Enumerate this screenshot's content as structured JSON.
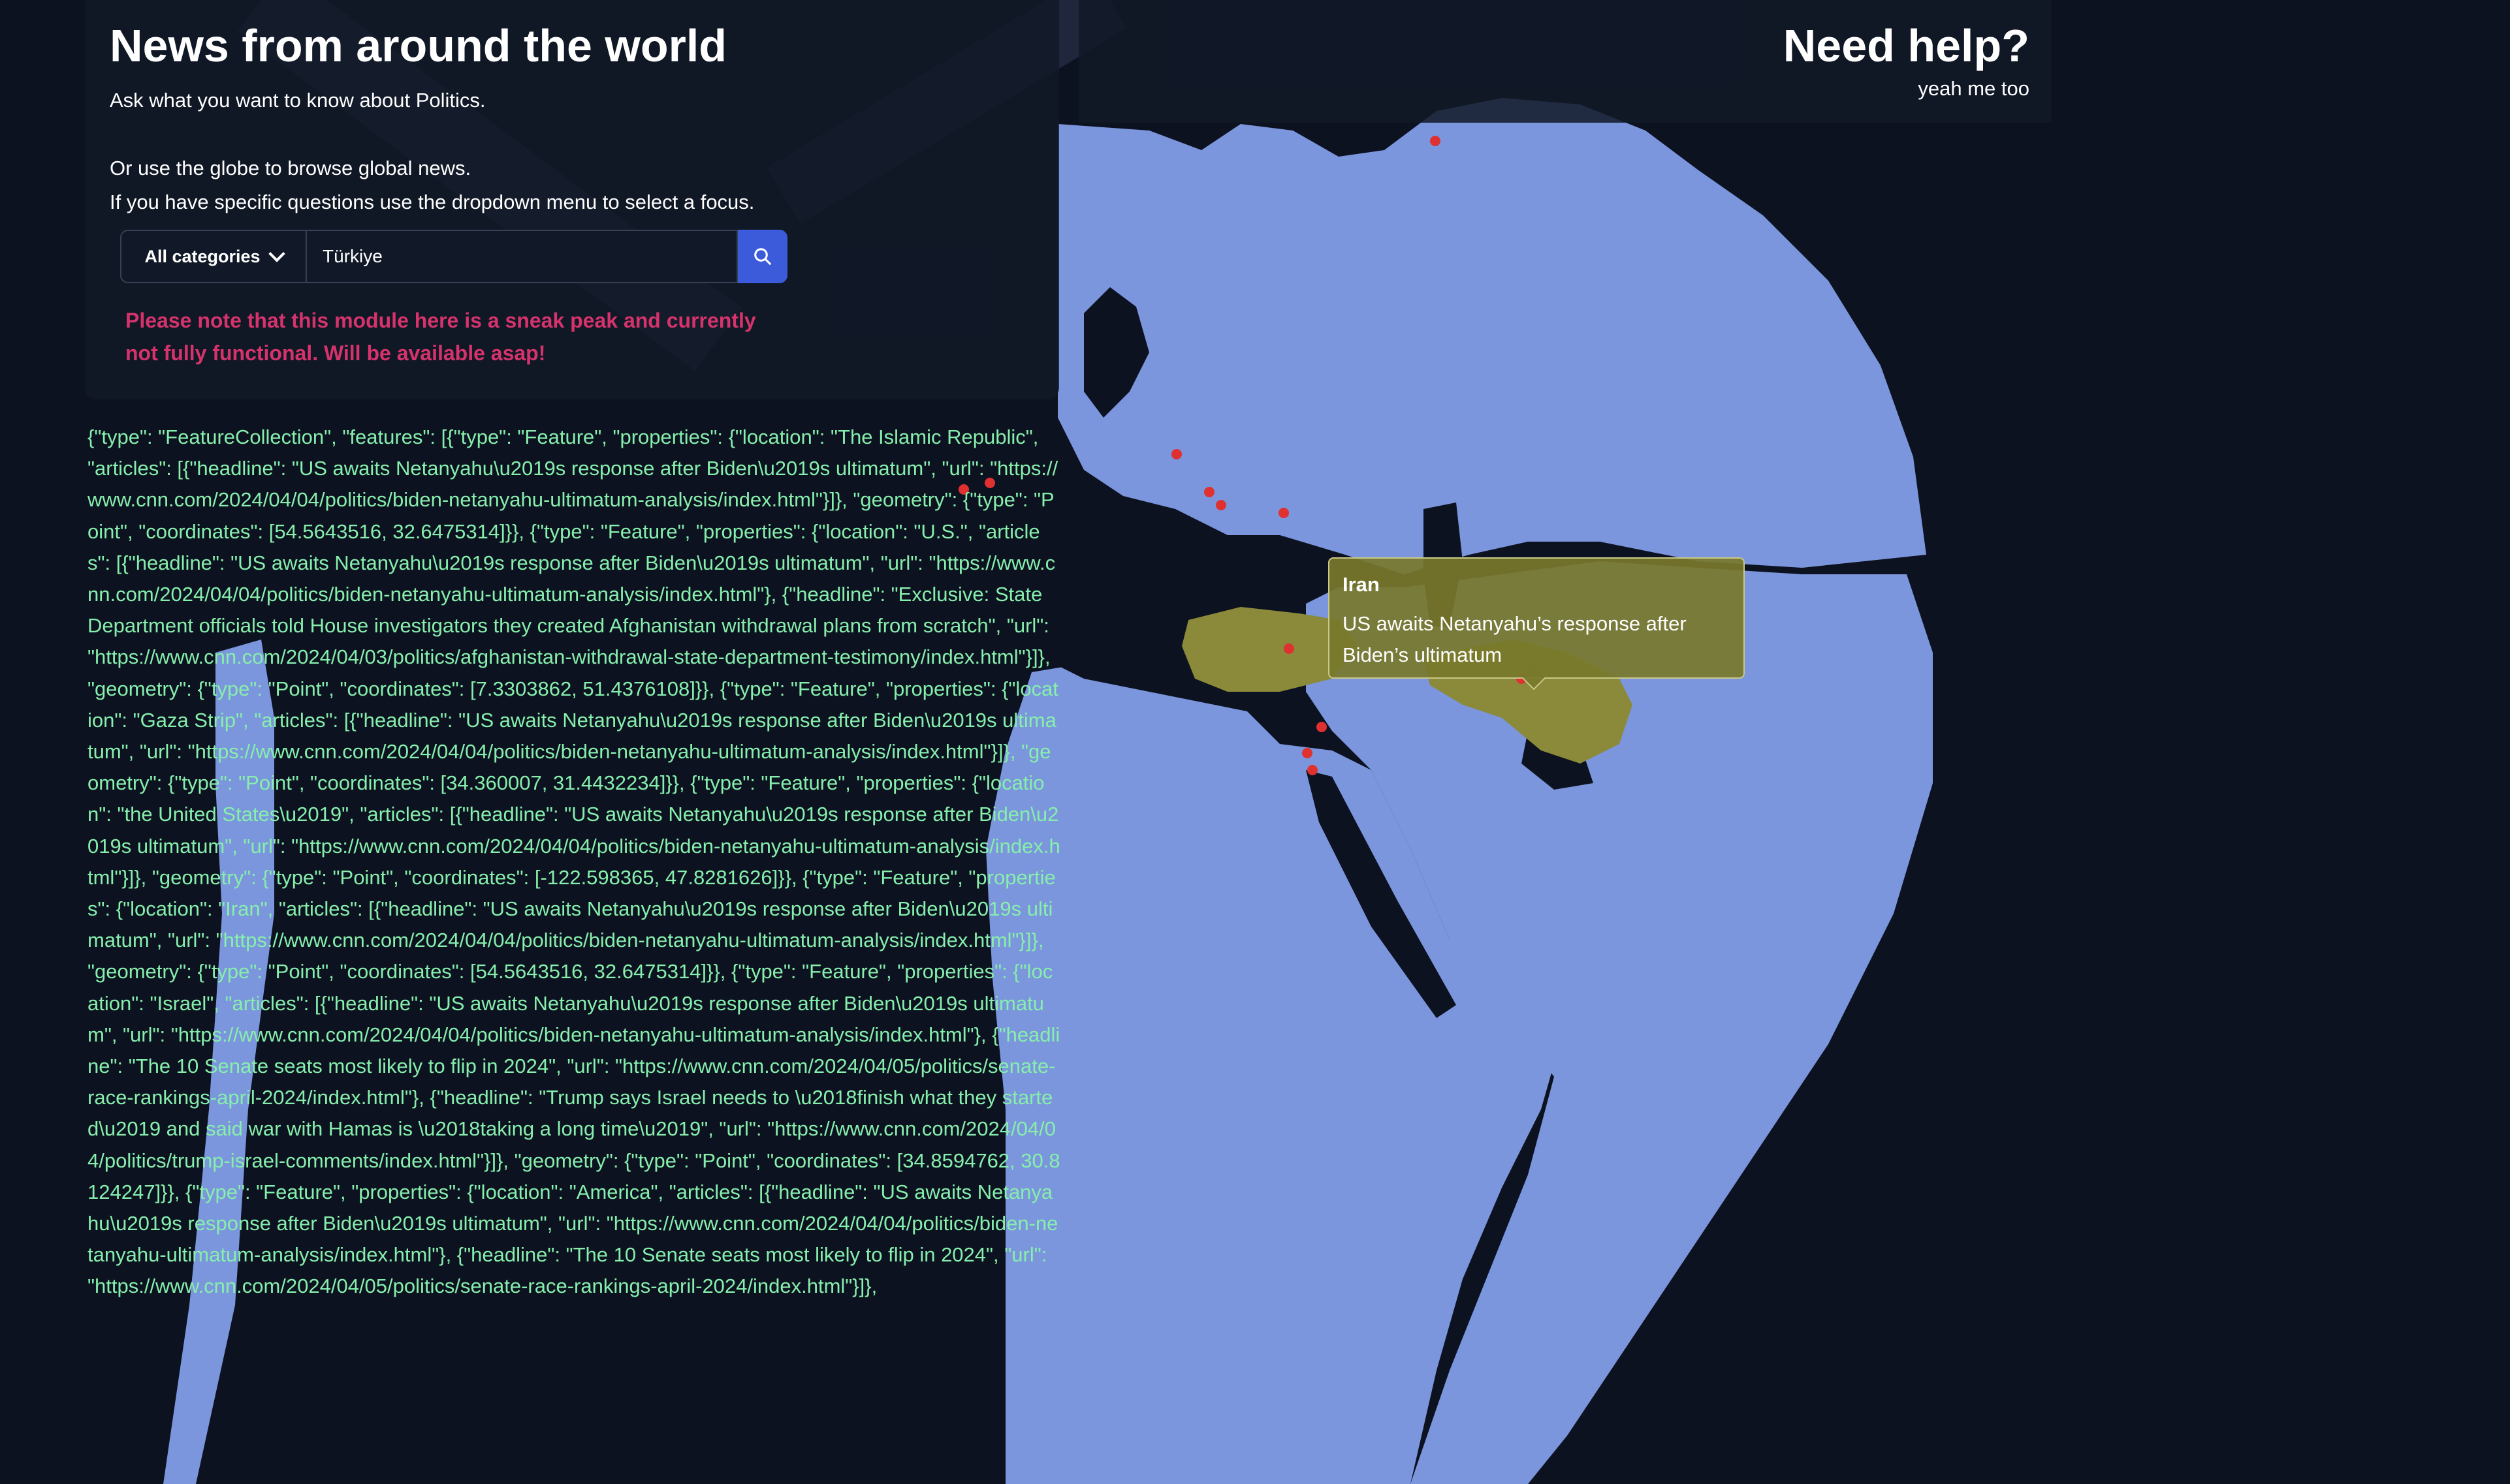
{
  "header": {
    "title": "News from around the world",
    "subtitle": "Ask what you want to know about Politics.",
    "line1": "Or use the globe to browse global news.",
    "line2": "If you have specific questions use the dropdown menu to select a focus."
  },
  "help": {
    "title": "Need help?",
    "subtitle": "yeah me too"
  },
  "search": {
    "category_label": "All categories",
    "value": "Türkiye",
    "button_icon": "search-icon"
  },
  "warning": "Please note that this module here is a sneak peak and currently not fully functional. Will be available asap!",
  "json_dump": "{\"type\": \"FeatureCollection\", \"features\": [{\"type\": \"Feature\", \"properties\": {\"location\": \"The Islamic Republic\", \"articles\": [{\"headline\": \"US awaits Netanyahu\\u2019s response after Biden\\u2019s ultimatum\", \"url\": \"https://www.cnn.com/2024/04/04/politics/biden-netanyahu-ultimatum-analysis/index.html\"}]}, \"geometry\": {\"type\": \"Point\", \"coordinates\": [54.5643516, 32.6475314]}}, {\"type\": \"Feature\", \"properties\": {\"location\": \"U.S.\", \"articles\": [{\"headline\": \"US awaits Netanyahu\\u2019s response after Biden\\u2019s ultimatum\", \"url\": \"https://www.cnn.com/2024/04/04/politics/biden-netanyahu-ultimatum-analysis/index.html\"}, {\"headline\": \"Exclusive: State Department officials told House investigators they created Afghanistan withdrawal plans from scratch\", \"url\": \"https://www.cnn.com/2024/04/03/politics/afghanistan-withdrawal-state-department-testimony/index.html\"}]}, \"geometry\": {\"type\": \"Point\", \"coordinates\": [7.3303862, 51.4376108]}}, {\"type\": \"Feature\", \"properties\": {\"location\": \"Gaza Strip\", \"articles\": [{\"headline\": \"US awaits Netanyahu\\u2019s response after Biden\\u2019s ultimatum\", \"url\": \"https://www.cnn.com/2024/04/04/politics/biden-netanyahu-ultimatum-analysis/index.html\"}]}, \"geometry\": {\"type\": \"Point\", \"coordinates\": [34.360007, 31.4432234]}}, {\"type\": \"Feature\", \"properties\": {\"location\": \"the United States\\u2019\", \"articles\": [{\"headline\": \"US awaits Netanyahu\\u2019s response after Biden\\u2019s ultimatum\", \"url\": \"https://www.cnn.com/2024/04/04/politics/biden-netanyahu-ultimatum-analysis/index.html\"}]}, \"geometry\": {\"type\": \"Point\", \"coordinates\": [-122.598365, 47.8281626]}}, {\"type\": \"Feature\", \"properties\": {\"location\": \"Iran\", \"articles\": [{\"headline\": \"US awaits Netanyahu\\u2019s response after Biden\\u2019s ultimatum\", \"url\": \"https://www.cnn.com/2024/04/04/politics/biden-netanyahu-ultimatum-analysis/index.html\"}]}, \"geometry\": {\"type\": \"Point\", \"coordinates\": [54.5643516, 32.6475314]}}, {\"type\": \"Feature\", \"properties\": {\"location\": \"Israel\", \"articles\": [{\"headline\": \"US awaits Netanyahu\\u2019s response after Biden\\u2019s ultimatum\", \"url\": \"https://www.cnn.com/2024/04/04/politics/biden-netanyahu-ultimatum-analysis/index.html\"}, {\"headline\": \"The 10 Senate seats most likely to flip in 2024\", \"url\": \"https://www.cnn.com/2024/04/05/politics/senate-race-rankings-april-2024/index.html\"}, {\"headline\": \"Trump says Israel needs to \\u2018finish what they started\\u2019 and said war with Hamas is \\u2018taking a long time\\u2019\", \"url\": \"https://www.cnn.com/2024/04/04/politics/trump-israel-comments/index.html\"}]}, \"geometry\": {\"type\": \"Point\", \"coordinates\": [34.8594762, 30.8124247]}}, {\"type\": \"Feature\", \"properties\": {\"location\": \"America\", \"articles\": [{\"headline\": \"US awaits Netanyahu\\u2019s response after Biden\\u2019s ultimatum\", \"url\": \"https://www.cnn.com/2024/04/04/politics/biden-netanyahu-ultimatum-analysis/index.html\"}, {\"headline\": \"The 10 Senate seats most likely to flip in 2024\", \"url\": \"https://www.cnn.com/2024/04/05/politics/senate-race-rankings-april-2024/index.html\"}]},",
  "tooltip": {
    "title": "Iran",
    "headline": "US awaits Netanyahu’s response after Biden’s ultimatum"
  },
  "colors": {
    "globe_land": "#7b96dc",
    "ocean": "#0d1221",
    "highlight": "#8a8a3a",
    "marker": "#e03131",
    "json_text": "#86efac",
    "warning": "#d6336c",
    "search_button": "#3b5bdb"
  }
}
